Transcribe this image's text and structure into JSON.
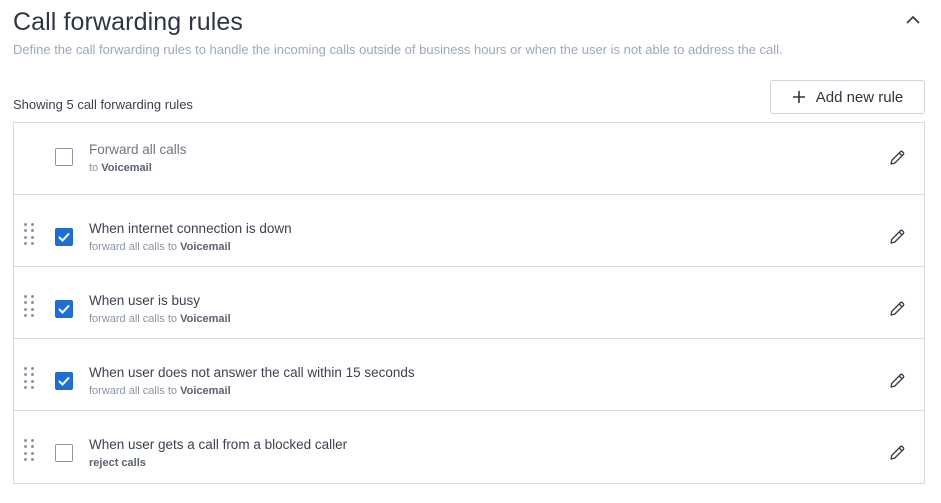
{
  "header": {
    "title": "Call forwarding rules",
    "subtitle": "Define the call forwarding rules to handle the incoming calls outside of business hours or when the user is not able to address the call.",
    "collapse_icon": "chevron-up-icon"
  },
  "toolbar": {
    "count_text": "Showing 5 call forwarding rules",
    "add_label": "Add new rule"
  },
  "rules": [
    {
      "title": "Forward all calls",
      "prefix": "to ",
      "target": "Voicemail",
      "checked": false,
      "draggable": false
    },
    {
      "title": "When internet connection is down",
      "prefix": "forward all calls to ",
      "target": "Voicemail",
      "checked": true,
      "draggable": true
    },
    {
      "title": "When user is busy",
      "prefix": "forward all calls to ",
      "target": "Voicemail",
      "checked": true,
      "draggable": true
    },
    {
      "title": "When user does not answer the call within 15 seconds",
      "prefix": "forward all calls to ",
      "target": "Voicemail",
      "checked": true,
      "draggable": true
    },
    {
      "title": "When user gets a call from a blocked caller",
      "action": "reject calls",
      "checked": false,
      "draggable": true
    }
  ],
  "colors": {
    "accent": "#1e6fd0",
    "border": "#d8dce2",
    "subtitle": "#9aa9bd"
  }
}
